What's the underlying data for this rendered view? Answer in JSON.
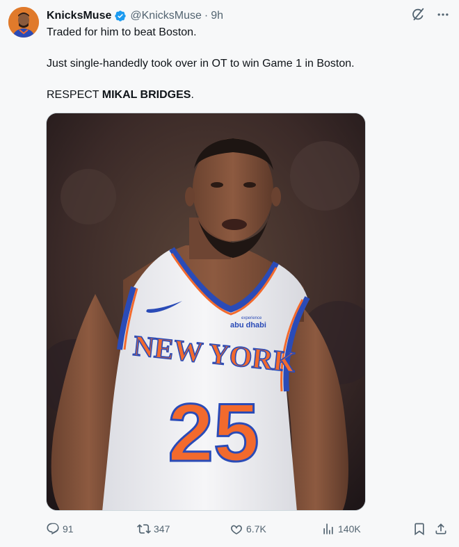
{
  "author": {
    "display_name": "KnicksMuse",
    "handle": "@KnicksMuse",
    "separator": "·",
    "time": "9h",
    "verified": true
  },
  "tweet": {
    "line1": "Traded for him to beat Boston.",
    "line2": "Just single-handedly took over in OT to win Game 1 in Boston.",
    "line3_prefix": "RESPECT ",
    "line3_bold": "MIKAL BRIDGES",
    "line3_suffix": "."
  },
  "image": {
    "jersey_text": "NEW YORK",
    "jersey_number": "25",
    "sponsor_small": "experience",
    "sponsor": "abu dhabi"
  },
  "actions": {
    "replies": "91",
    "retweets": "347",
    "likes": "6.7K",
    "views": "140K"
  },
  "colors": {
    "accent_blue": "#1d9bf0",
    "muted": "#536471",
    "knicks_orange": "#f26a2d",
    "knicks_blue": "#2a4bb7"
  },
  "icons": [
    "grok-icon",
    "more-icon",
    "reply-icon",
    "retweet-icon",
    "like-icon",
    "views-icon",
    "bookmark-icon",
    "share-icon",
    "verified-icon"
  ]
}
